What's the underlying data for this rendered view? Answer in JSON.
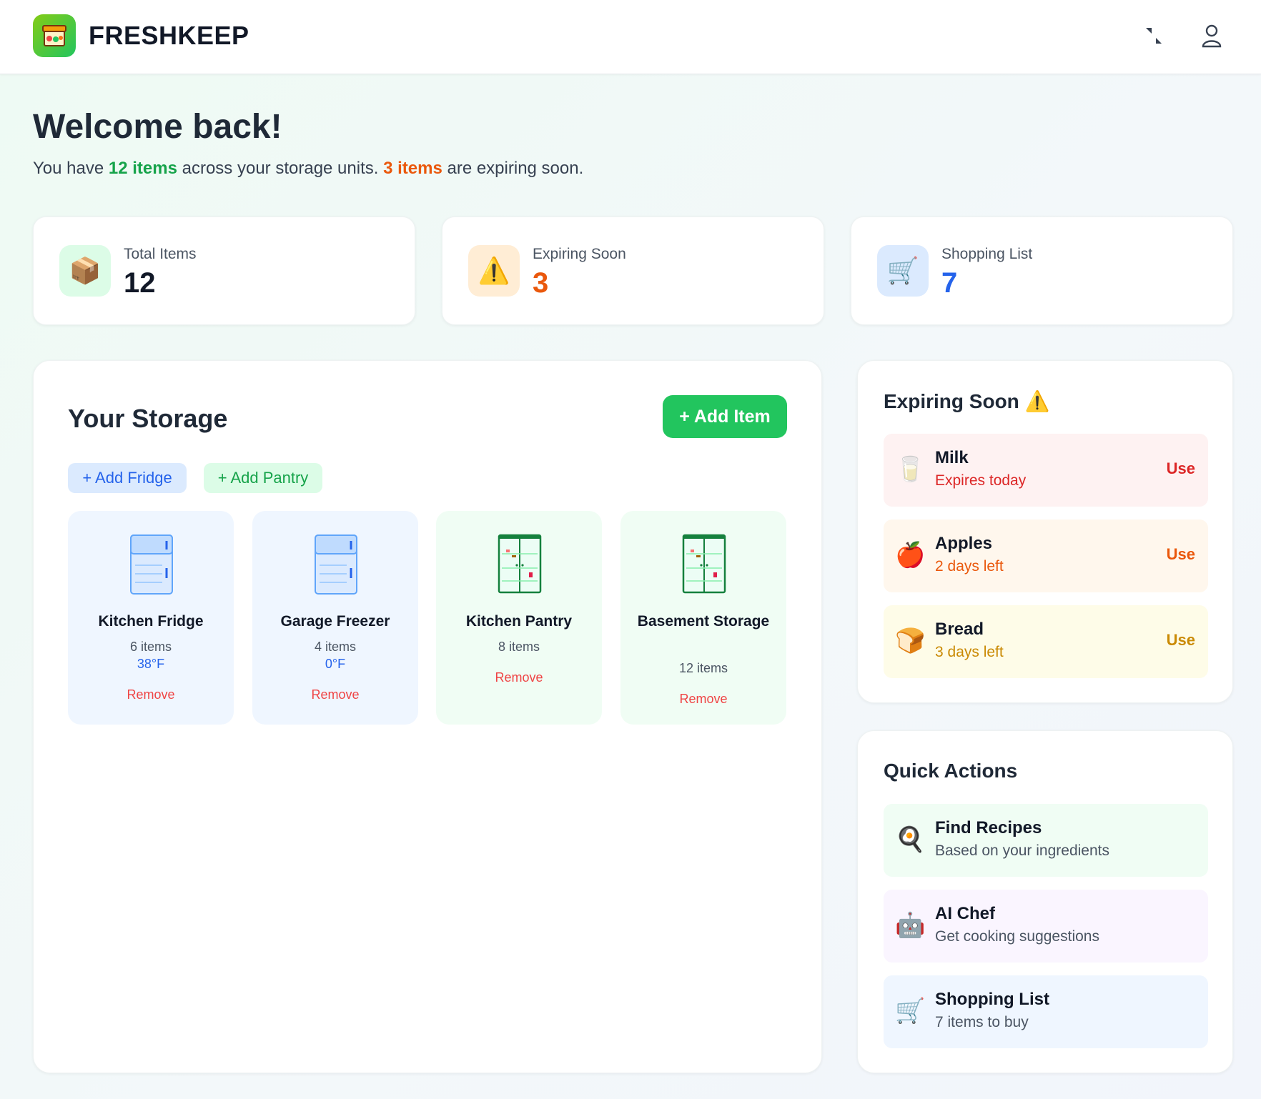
{
  "app": {
    "title": "FRESHKEEP"
  },
  "header": {
    "collapse_icon": "collapse-arrows-icon",
    "user_icon": "user-icon"
  },
  "welcome": {
    "heading": "Welcome back!",
    "line_prefix": "You have ",
    "items_count": "12 items",
    "line_mid": " across your storage units. ",
    "expiring_count": "3 items",
    "line_suffix": " are expiring soon."
  },
  "stats": [
    {
      "label": "Total Items",
      "value": "12",
      "icon": "📦",
      "icon_bg": "#dcfce7",
      "color": "#111827"
    },
    {
      "label": "Expiring Soon",
      "value": "3",
      "icon": "⚠️",
      "icon_bg": "#ffedd5",
      "color": "#ea580c"
    },
    {
      "label": "Shopping List",
      "value": "7",
      "icon": "🛒",
      "icon_bg": "#dbeafe",
      "color": "#2563eb"
    }
  ],
  "storage": {
    "title": "Your Storage",
    "add_item": "+ Add Item",
    "add_fridge": "+ Add Fridge",
    "add_pantry": "+ Add Pantry",
    "units": [
      {
        "name": "Kitchen Fridge",
        "count": "6 items",
        "temp": "38°F",
        "remove": "Remove",
        "kind": "fridge"
      },
      {
        "name": "Garage Freezer",
        "count": "4 items",
        "temp": "0°F",
        "remove": "Remove",
        "kind": "fridge"
      },
      {
        "name": "Kitchen Pantry",
        "count": "8 items",
        "temp": "",
        "remove": "Remove",
        "kind": "pantry"
      },
      {
        "name": "Basement Storage",
        "count": "12 items",
        "temp": "",
        "remove": "Remove",
        "kind": "pantry"
      }
    ]
  },
  "expiring": {
    "title": "Expiring Soon ⚠️",
    "items": [
      {
        "name": "Milk",
        "status": "Expires today",
        "action": "Use",
        "icon": "🥛",
        "bg": "#fef2f2",
        "color": "#dc2626"
      },
      {
        "name": "Apples",
        "status": "2 days left",
        "action": "Use",
        "icon": "🍎",
        "bg": "#fff7ed",
        "color": "#ea580c"
      },
      {
        "name": "Bread",
        "status": "3 days left",
        "action": "Use",
        "icon": "🍞",
        "bg": "#fefce8",
        "color": "#ca8a04"
      }
    ]
  },
  "quick_actions": {
    "title": "Quick Actions",
    "items": [
      {
        "name": "Find Recipes",
        "desc": "Based on your ingredients",
        "icon": "🍳",
        "bg": "#f0fdf4"
      },
      {
        "name": "AI Chef",
        "desc": "Get cooking suggestions",
        "icon": "🤖",
        "bg": "#faf5ff"
      },
      {
        "name": "Shopping List",
        "desc": "7 items to buy",
        "icon": "🛒",
        "bg": "#eff6ff"
      }
    ]
  }
}
